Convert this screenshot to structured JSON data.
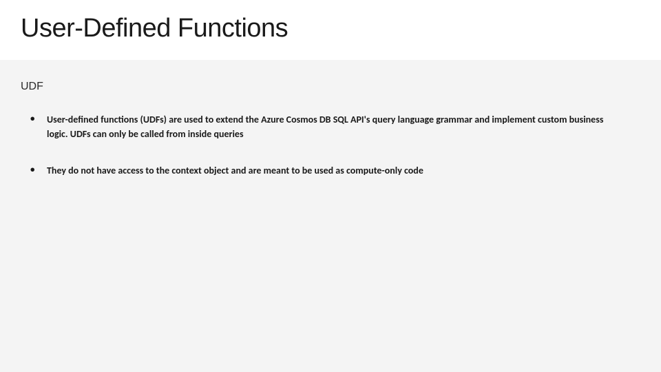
{
  "slide": {
    "title": "User-Defined Functions",
    "section_heading": "UDF",
    "bullets": [
      "User-defined functions (UDFs) are used to extend the Azure Cosmos DB SQL API's query language grammar and implement custom business logic. UDFs can only be called from inside queries",
      "They do not have access to the context object and are meant to be used as compute-only code"
    ]
  }
}
